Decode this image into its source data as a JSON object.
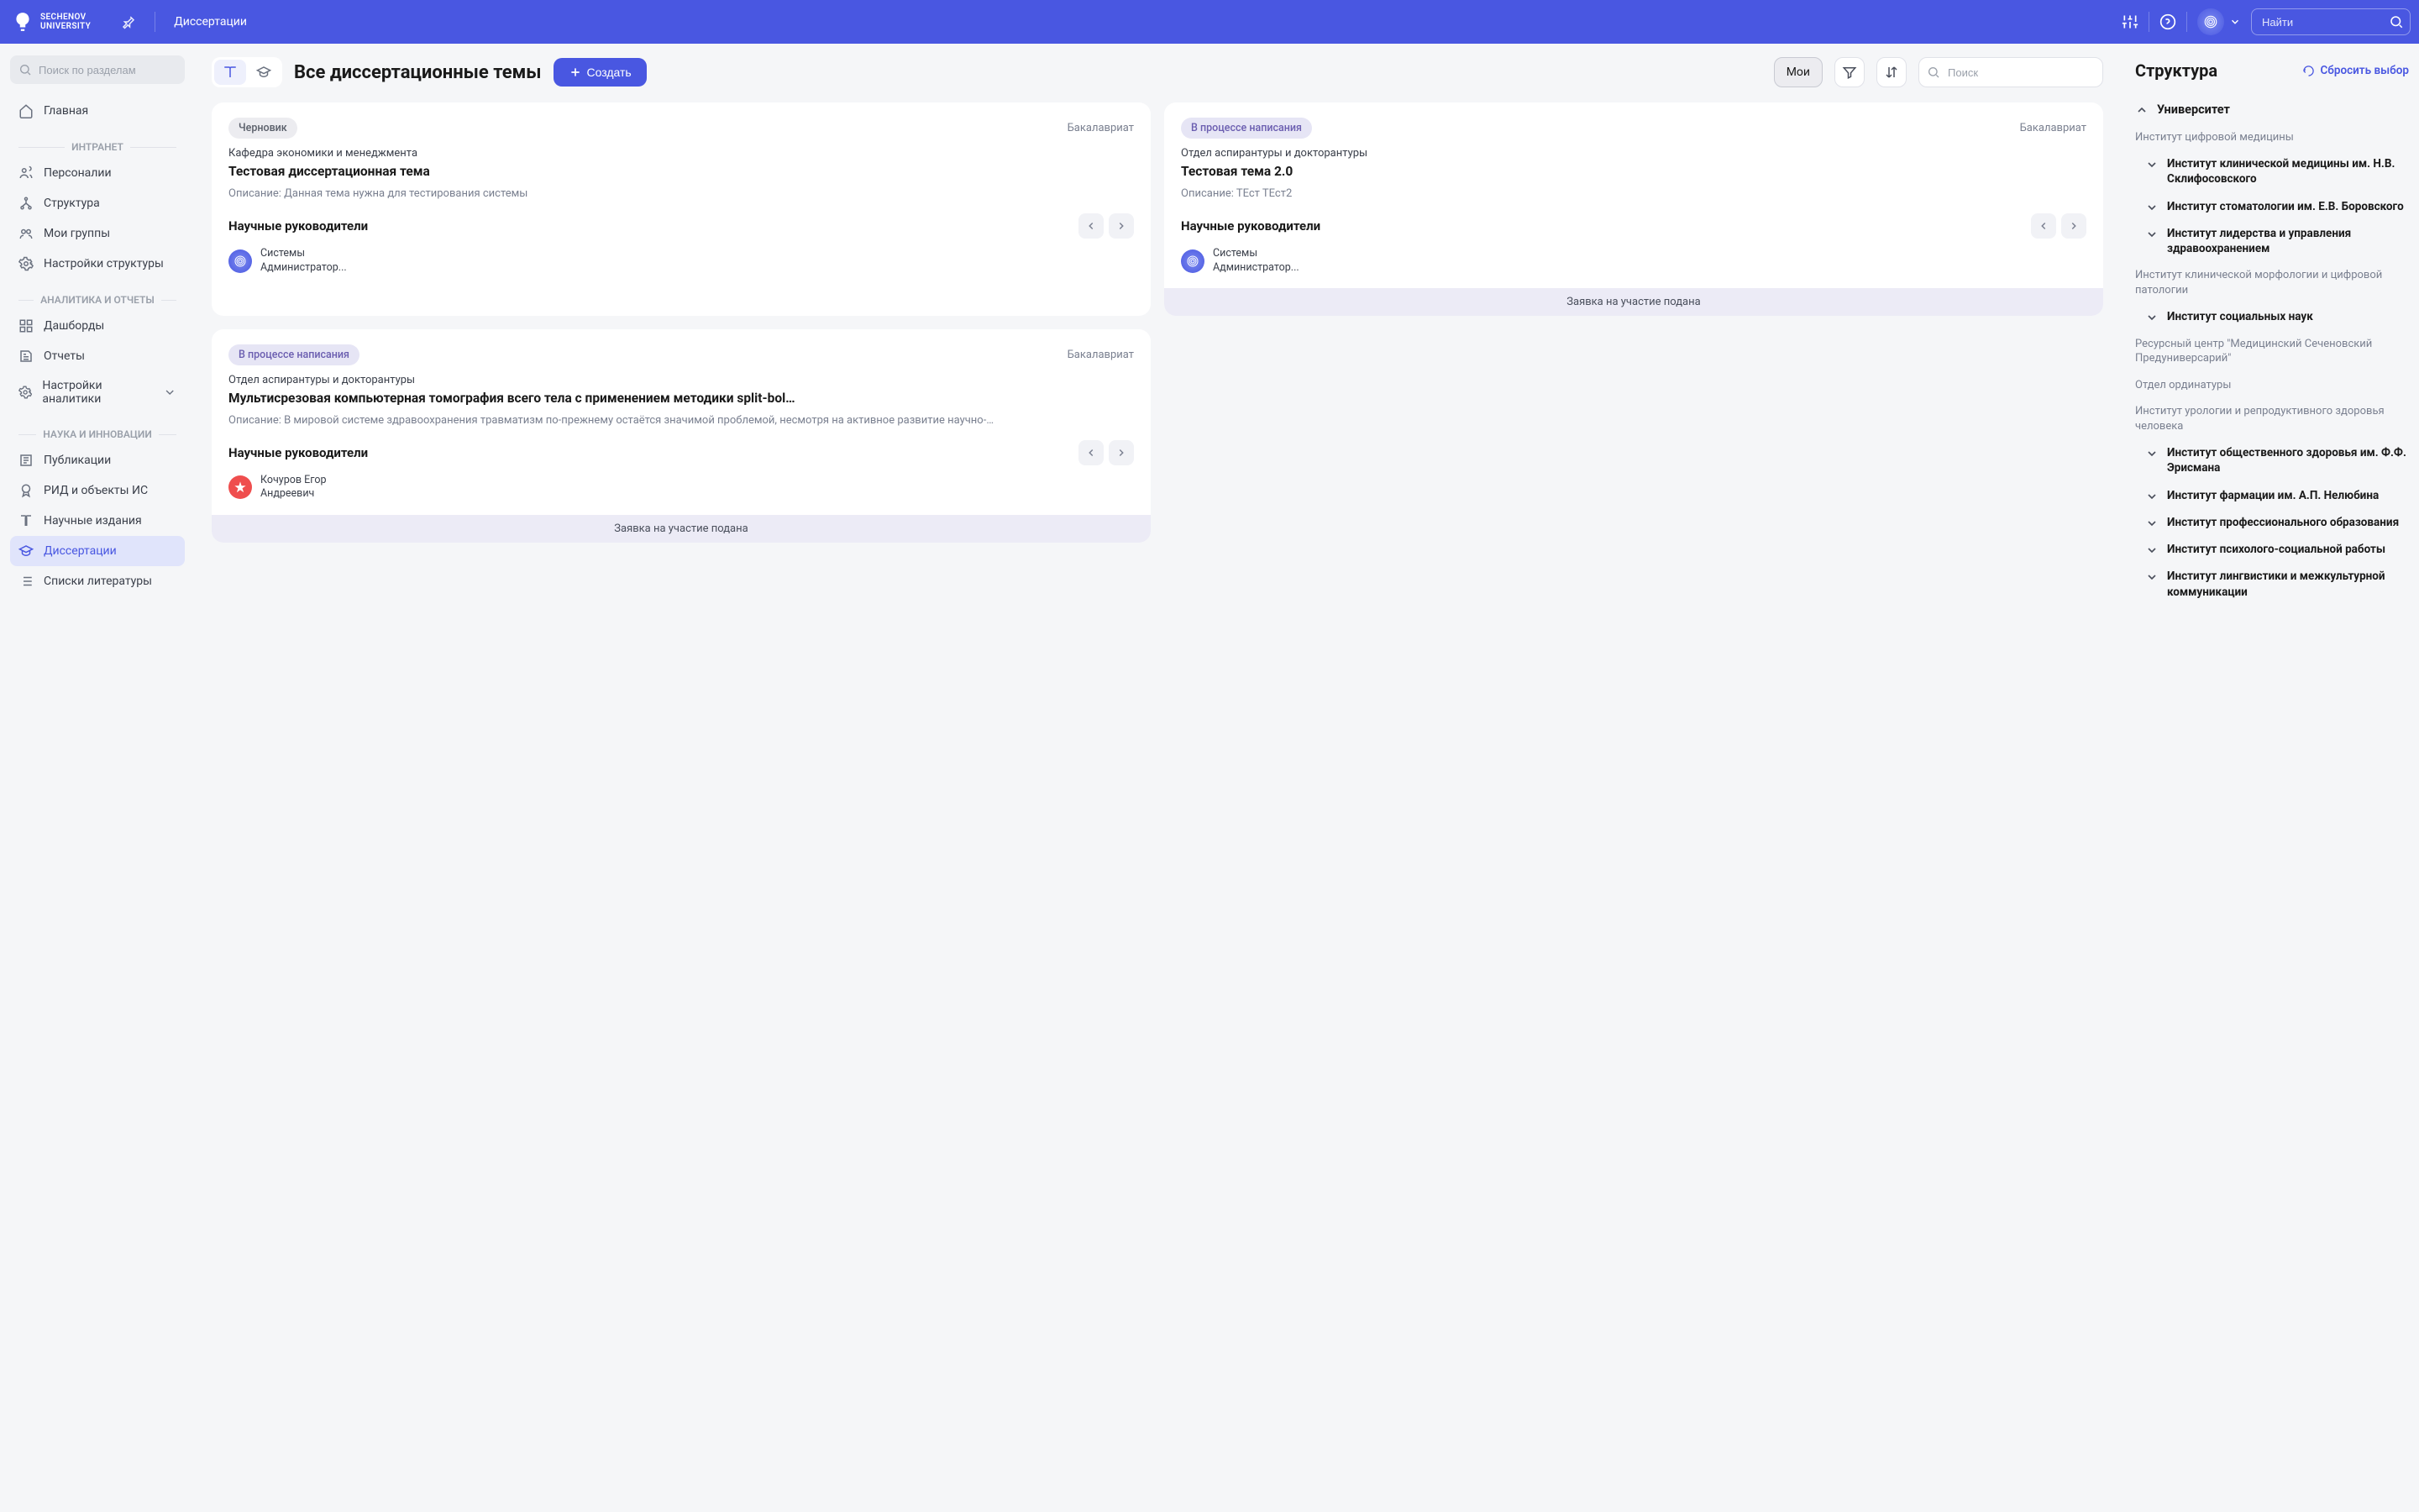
{
  "header": {
    "logo_top": "SECHENOV",
    "logo_bottom": "UNIVERSITY",
    "breadcrumb": "Диссертации",
    "search_placeholder": "Найти"
  },
  "sidebar": {
    "search_placeholder": "Поиск по разделам",
    "home": "Главная",
    "sections": {
      "intranet": {
        "label": "ИНТРАНЕТ",
        "items": {
          "personalii": "Персоналии",
          "structure": "Структура",
          "my_groups": "Мои группы",
          "structure_settings": "Настройки структуры"
        }
      },
      "analytics": {
        "label": "АНАЛИТИКА И ОТЧЕТЫ",
        "items": {
          "dashboards": "Дашборды",
          "reports": "Отчеты",
          "analytics_settings": "Настройки аналитики"
        }
      },
      "science": {
        "label": "НАУКА И ИННОВАЦИИ",
        "items": {
          "publications": "Публикации",
          "rid": "РИД и объекты ИС",
          "journals": "Научные издания",
          "dissertations": "Диссертации",
          "bibliography": "Списки литературы"
        }
      }
    }
  },
  "main": {
    "title": "Все диссертационные темы",
    "create_button": "Создать",
    "filter_mine": "Мои",
    "search_placeholder": "Поиск"
  },
  "cards": [
    {
      "status": "Черновик",
      "status_kind": "draft",
      "level": "Бакалавриат",
      "department": "Кафедра экономики и менеджмента",
      "title": "Тестовая диссертационная тема",
      "description": "Описание: Данная тема нужна для тестирования системы",
      "supervisors_label": "Научные руководители",
      "supervisor_name": "Системы\nАдминистратор...",
      "supervisor_kind": "sys",
      "footer": ""
    },
    {
      "status": "В процессе написания",
      "status_kind": "progress",
      "level": "Бакалавриат",
      "department": "Отдел аспирантуры и докторантуры",
      "title": "Тестовая тема 2.0",
      "description": "Описание: ТЕст ТЕст2",
      "supervisors_label": "Научные руководители",
      "supervisor_name": "Системы\nАдминистратор...",
      "supervisor_kind": "sys",
      "footer": "Заявка на участие подана"
    },
    {
      "status": "В процессе написания",
      "status_kind": "progress",
      "level": "Бакалавриат",
      "department": "Отдел аспирантуры и докторантуры",
      "title": "Мультисрезовая компьютерная томография всего тела c применением методики split-bol…",
      "description": "Описание: В мировой системе здравоохранения травматизм по-прежнему остаётся значимой проблемой, несмотря на активное развитие научно-…",
      "supervisors_label": "Научные руководители",
      "supervisor_name": "Кочуров Егор\nАндреевич",
      "supervisor_kind": "red",
      "footer": "Заявка на участие подана"
    }
  ],
  "right": {
    "title": "Структура",
    "reset": "Сбросить выбор",
    "root": "Университет",
    "nodes": {
      "digital_med": "Институт цифровой медицины",
      "sklifosovsky": "Институт клинической медицины им. Н.В. Склифосовского",
      "borovsky": "Институт стоматологии им. Е.В. Боровского",
      "leadership": "Институт лидерства и управления здравоохранением",
      "morphology": "Институт клинической морфологии и цифровой патологии",
      "social": "Институт социальных наук",
      "resource_center": "Ресурсный центр \"Медицинский Сеченовский Предуниверсарий\"",
      "ordinatura": "Отдел ординатуры",
      "urology": "Институт урологии и репродуктивного здоровья человека",
      "erisman": "Институт общественного здоровья им. Ф.Ф. Эрисмана",
      "pharmacy": "Институт фармации им. А.П. Нелюбина",
      "professional": "Институт профессионального образования",
      "psycho": "Институт психолого-социальной работы",
      "linguistics": "Институт лингвистики и межкультурной коммуникации"
    }
  }
}
